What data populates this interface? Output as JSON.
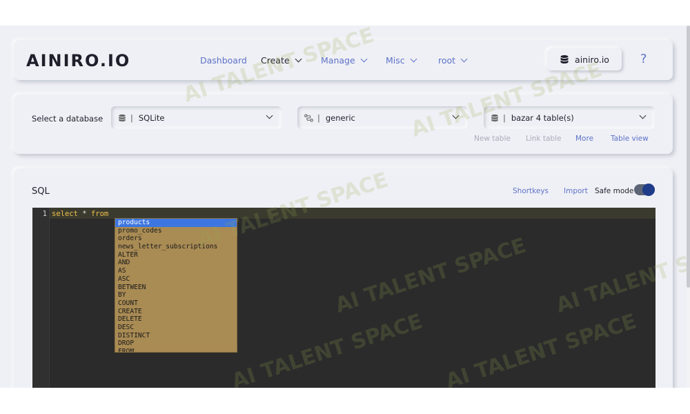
{
  "header": {
    "logo": "AINIRO.IO",
    "nav": [
      {
        "label": "Dashboard",
        "has_chevron": false
      },
      {
        "label": "Create",
        "has_chevron": true
      },
      {
        "label": "Manage",
        "has_chevron": true
      },
      {
        "label": "Misc",
        "has_chevron": true
      },
      {
        "label": "root",
        "has_chevron": true
      }
    ],
    "user_button": {
      "icon": "database-icon",
      "label": "ainiro.io"
    },
    "help_label": "?"
  },
  "selectors": {
    "label": "Select a database",
    "database_type": {
      "icon": "database-icon",
      "value": "SQLite"
    },
    "connection": {
      "icon": "connection-icon",
      "value": "generic"
    },
    "database": {
      "icon": "database-icon",
      "value": "bazar 4 table(s)"
    },
    "links": {
      "new_table": "New table",
      "link_table": "Link table",
      "more": "More",
      "table_view": "Table view"
    }
  },
  "sql": {
    "title": "SQL",
    "shortkeys": "Shortkeys",
    "import": "Import",
    "safe_mode_label": "Safe mode",
    "safe_mode_on": true,
    "editor": {
      "line_number": "1",
      "code_keyword": "select",
      "code_op": "*",
      "code_keyword2": "from"
    },
    "autocomplete": {
      "selected": "products",
      "items": [
        "products",
        "promo_codes",
        "orders",
        "news_letter_subscriptions",
        "ALTER",
        "AND",
        "AS",
        "ASC",
        "BETWEEN",
        "BY",
        "COUNT",
        "CREATE",
        "DELETE",
        "DESC",
        "DISTINCT",
        "DROP",
        "FROM"
      ]
    }
  },
  "watermark": "AI TALENT SPACE",
  "colors": {
    "accent": "#5d72c8",
    "editor_bg": "#2b2b2b",
    "hint_bg": "#a98b54",
    "hint_selected": "#3d76e0",
    "toggle_knob": "#1f3c8a"
  }
}
